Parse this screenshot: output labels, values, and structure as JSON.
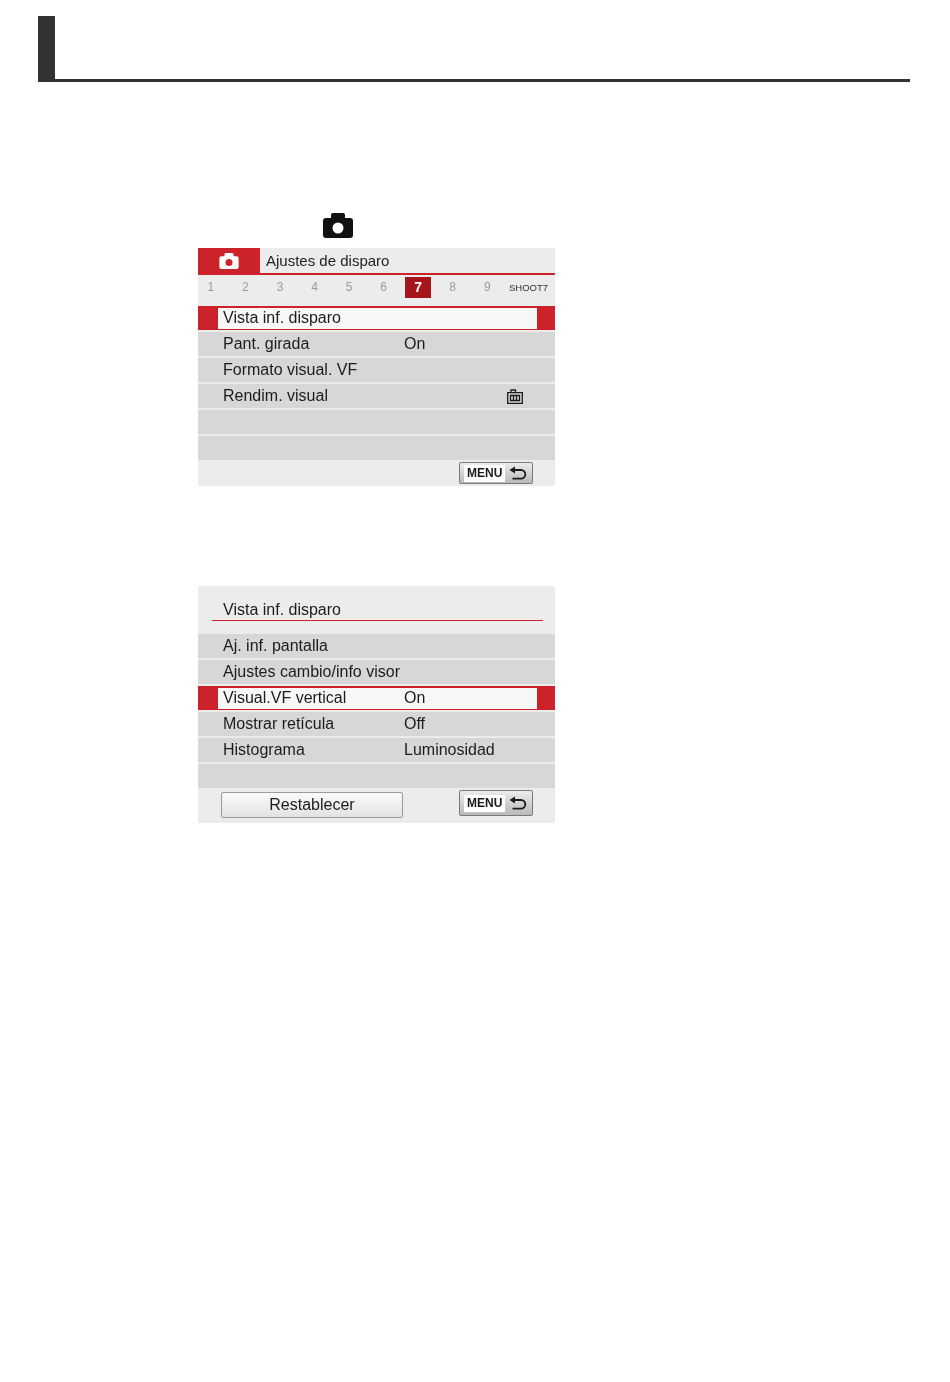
{
  "menu_screen": {
    "menu_title": "Ajustes de disparo",
    "page_tabs": [
      {
        "label": "1",
        "selected": false
      },
      {
        "label": "2",
        "selected": false
      },
      {
        "label": "3",
        "selected": false
      },
      {
        "label": "4",
        "selected": false
      },
      {
        "label": "5",
        "selected": false
      },
      {
        "label": "6",
        "selected": false
      },
      {
        "label": "7",
        "selected": true
      },
      {
        "label": "8",
        "selected": false
      },
      {
        "label": "9",
        "selected": false
      }
    ],
    "page_name": "SHOOT7",
    "items": [
      {
        "kind": "text",
        "label": "Vista inf. disparo",
        "selected": true
      },
      {
        "kind": "text",
        "label": "Pant. girada",
        "value": "On",
        "selected": false
      },
      {
        "kind": "text",
        "label": "Formato visual. VF",
        "selected": false
      },
      {
        "kind": "icon",
        "label": "Rendim. visual",
        "selected": false
      }
    ],
    "menu_key": "MENU"
  },
  "detail_screen": {
    "title": "Vista inf. disparo",
    "items": [
      {
        "label": "Aj. inf. pantalla",
        "selected": false
      },
      {
        "label": "Ajustes cambio/info visor",
        "selected": false
      },
      {
        "label": "Visual.VF vertical",
        "value": "On",
        "selected": true
      },
      {
        "label": "Mostrar retícula",
        "value": "Off",
        "selected": false
      },
      {
        "label": "Histograma",
        "value": "Luminosidad",
        "selected": false
      }
    ],
    "reset_button": "Restablecer",
    "menu_key": "MENU"
  }
}
